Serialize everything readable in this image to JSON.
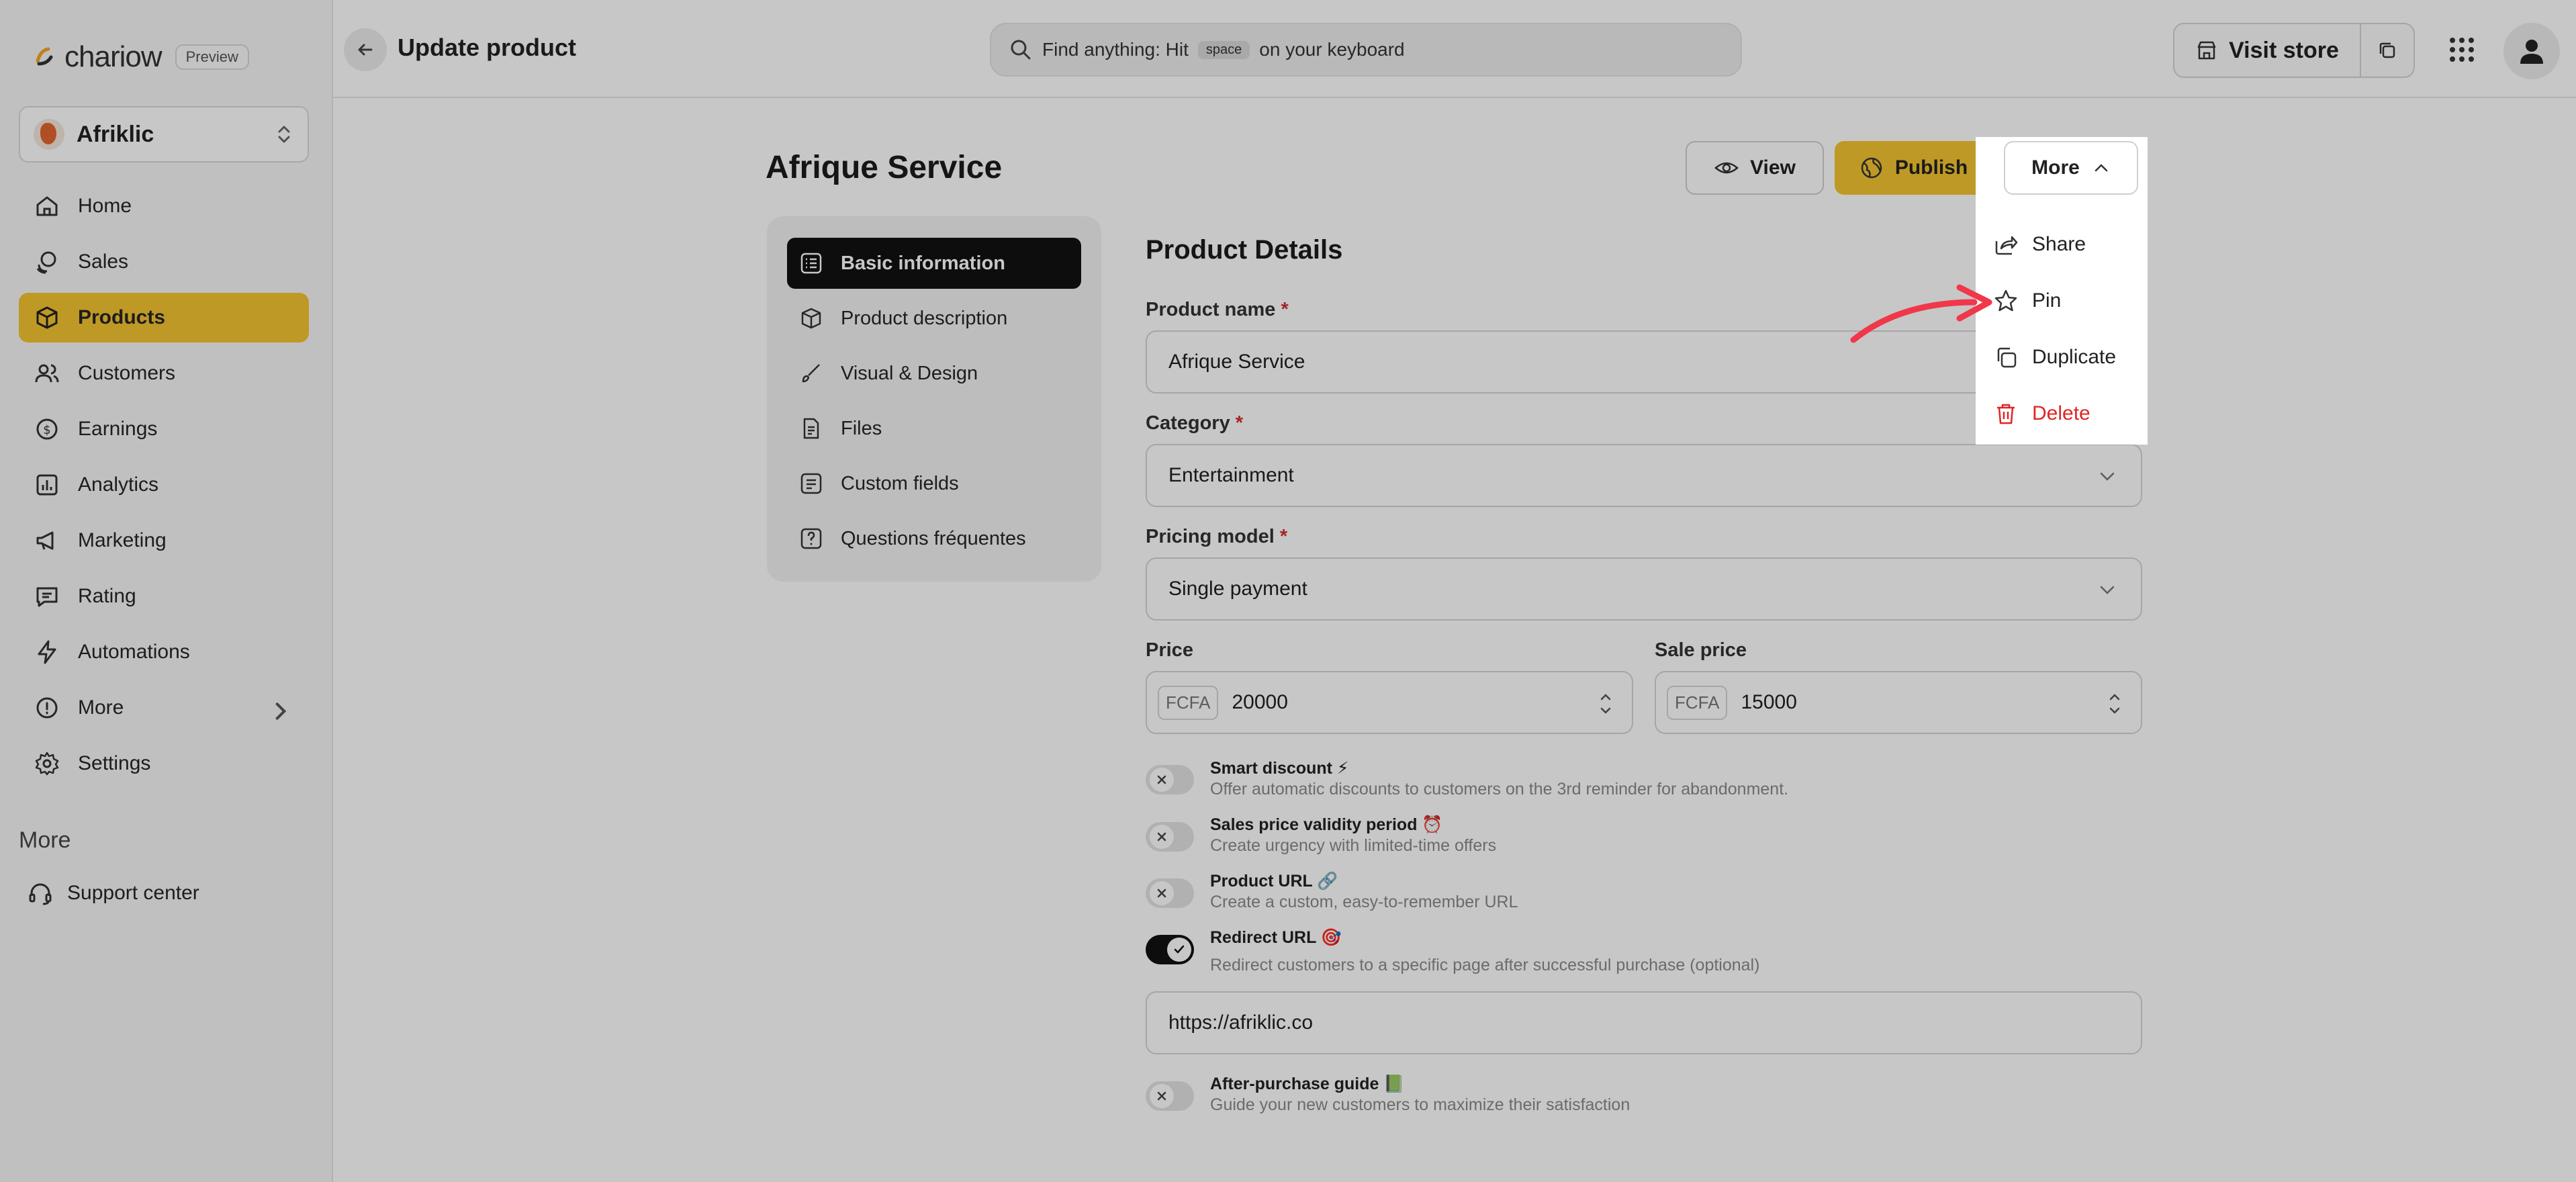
{
  "brand": {
    "name": "chariow",
    "badge": "Preview"
  },
  "store": {
    "name": "Afriklic"
  },
  "nav": [
    {
      "label": "Home",
      "icon": "home-icon"
    },
    {
      "label": "Sales",
      "icon": "coins-icon"
    },
    {
      "label": "Products",
      "icon": "box-icon",
      "active": true
    },
    {
      "label": "Customers",
      "icon": "users-icon"
    },
    {
      "label": "Earnings",
      "icon": "dollar-circle-icon"
    },
    {
      "label": "Analytics",
      "icon": "bar-chart-icon"
    },
    {
      "label": "Marketing",
      "icon": "megaphone-icon"
    },
    {
      "label": "Rating",
      "icon": "message-icon"
    },
    {
      "label": "Automations",
      "icon": "lightning-icon"
    },
    {
      "label": "More",
      "icon": "info-icon"
    },
    {
      "label": "Settings",
      "icon": "gear-icon"
    }
  ],
  "sidebar_section": "More",
  "support": {
    "label": "Support center"
  },
  "topbar": {
    "title": "Update product",
    "search_prefix": "Find anything: Hit",
    "search_key": "space",
    "search_suffix": "on your keyboard",
    "visit_store": "Visit store"
  },
  "product": {
    "title": "Afrique Service",
    "view_label": "View",
    "publish_label": "Publish",
    "more_label": "More"
  },
  "more_menu": [
    {
      "label": "Share",
      "icon": "share-icon"
    },
    {
      "label": "Pin",
      "icon": "star-icon"
    },
    {
      "label": "Duplicate",
      "icon": "duplicate-icon"
    },
    {
      "label": "Delete",
      "icon": "trash-icon",
      "danger": true
    }
  ],
  "tabs": [
    {
      "label": "Basic information",
      "active": true
    },
    {
      "label": "Product description"
    },
    {
      "label": "Visual & Design"
    },
    {
      "label": "Files"
    },
    {
      "label": "Custom fields"
    },
    {
      "label": "Questions fréquentes"
    }
  ],
  "form": {
    "section_title": "Product Details",
    "name_label": "Product name",
    "name_value": "Afrique Service",
    "category_label": "Category",
    "category_value": "Entertainment",
    "pricing_label": "Pricing model",
    "pricing_value": "Single payment",
    "price_label": "Price",
    "price_currency": "FCFA",
    "price_value": "20000",
    "sale_label": "Sale price",
    "sale_currency": "FCFA",
    "sale_value": "15000",
    "required_mark": "*",
    "redirect_url": "https://afriklic.co"
  },
  "toggles": [
    {
      "title": "Smart discount ⚡",
      "desc": "Offer automatic discounts to customers on the 3rd reminder for abandonment.",
      "on": false
    },
    {
      "title": "Sales price validity period ⏰",
      "desc": "Create urgency with limited-time offers",
      "on": false
    },
    {
      "title": "Product URL 🔗",
      "desc": "Create a custom, easy-to-remember URL",
      "on": false
    },
    {
      "title": "Redirect URL 🎯",
      "desc": "Redirect customers to a specific page after successful purchase (optional)",
      "on": true
    },
    {
      "title": "After-purchase guide 📗",
      "desc": "Guide your new customers to maximize their satisfaction",
      "on": false
    }
  ],
  "colors": {
    "accent": "#f5c430",
    "danger": "#e02424",
    "annotation_arrow": "#f0384a"
  }
}
